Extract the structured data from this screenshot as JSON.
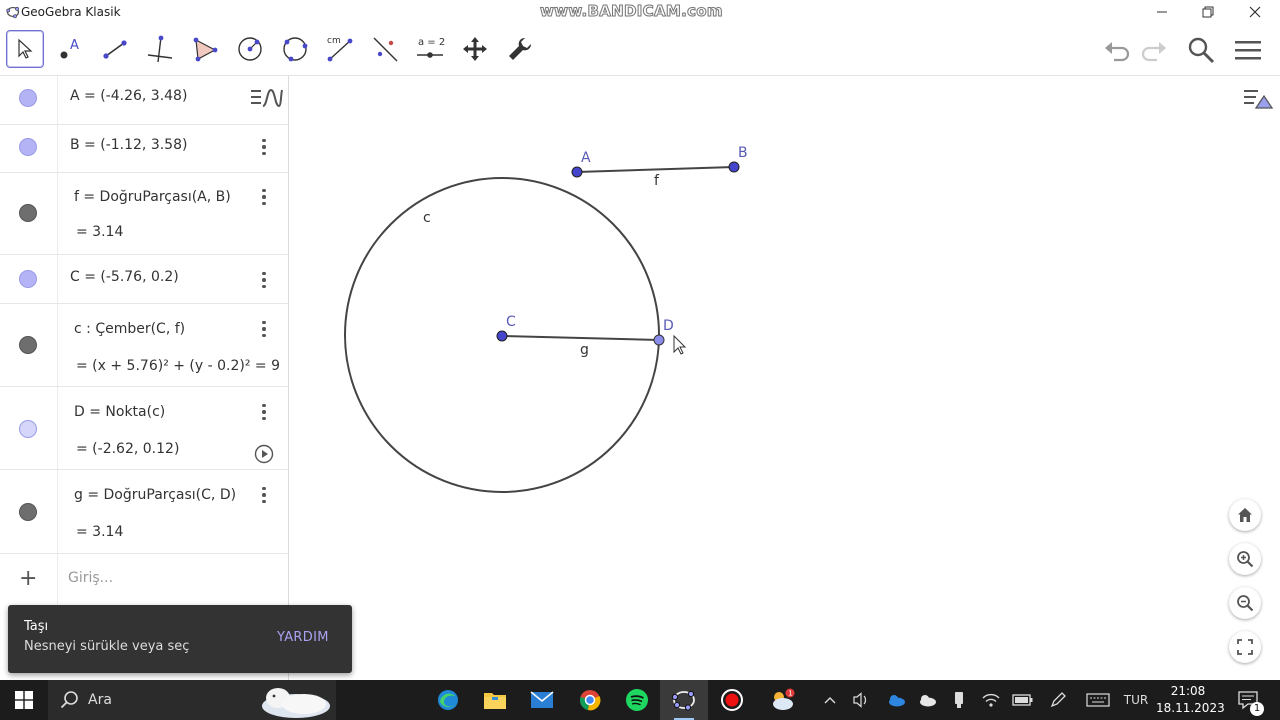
{
  "window": {
    "title": "GeoGebra Klasik",
    "watermark": "www.BANDICAM.com"
  },
  "toolbar": {
    "tools": [
      "move",
      "point",
      "segment",
      "perpendicular-line",
      "polygon",
      "circle-center-point",
      "circle-three-points",
      "measure-angle",
      "reflect",
      "slider",
      "move-graphics-view",
      "settings"
    ],
    "measure_label": "cm",
    "slider_label": "a = 2"
  },
  "algebra": {
    "rows": [
      {
        "line1": "A = (-4.26, 3.48)",
        "color": "#b3b3f5"
      },
      {
        "line1": "B = (-1.12, 3.58)",
        "color": "#b3b3f5"
      },
      {
        "line1": "f = DoğruParçası(A, B)",
        "line2": "= 3.14",
        "color": "#6e6e6e"
      },
      {
        "line1": "C = (-5.76, 0.2)",
        "color": "#b3b3f5"
      },
      {
        "line1": "c : Çember(C, f)",
        "line2": "= (x + 5.76)² + (y - 0.2)² = 9",
        "color": "#6e6e6e"
      },
      {
        "line1": "D = Nokta(c)",
        "line2": "= (-2.62, 0.12)",
        "color": "#d6d6fa"
      },
      {
        "line1": "g = DoğruParçası(C, D)",
        "line2": "= 3.14",
        "color": "#6e6e6e"
      }
    ],
    "input_placeholder": "Giriş..."
  },
  "graphics": {
    "labels": {
      "A": "A",
      "B": "B",
      "f": "f",
      "c": "c",
      "C": "C",
      "D": "D",
      "g": "g"
    },
    "point_color": "#4444cc",
    "label_color": "#5a5ab8"
  },
  "toast": {
    "title": "Taşı",
    "description": "Nesneyi sürükle veya seç",
    "help": "YARDIM"
  },
  "taskbar": {
    "search_text": "Ara",
    "language": "TUR",
    "time": "21:08",
    "date": "18.11.2023",
    "notification_count": "1"
  }
}
